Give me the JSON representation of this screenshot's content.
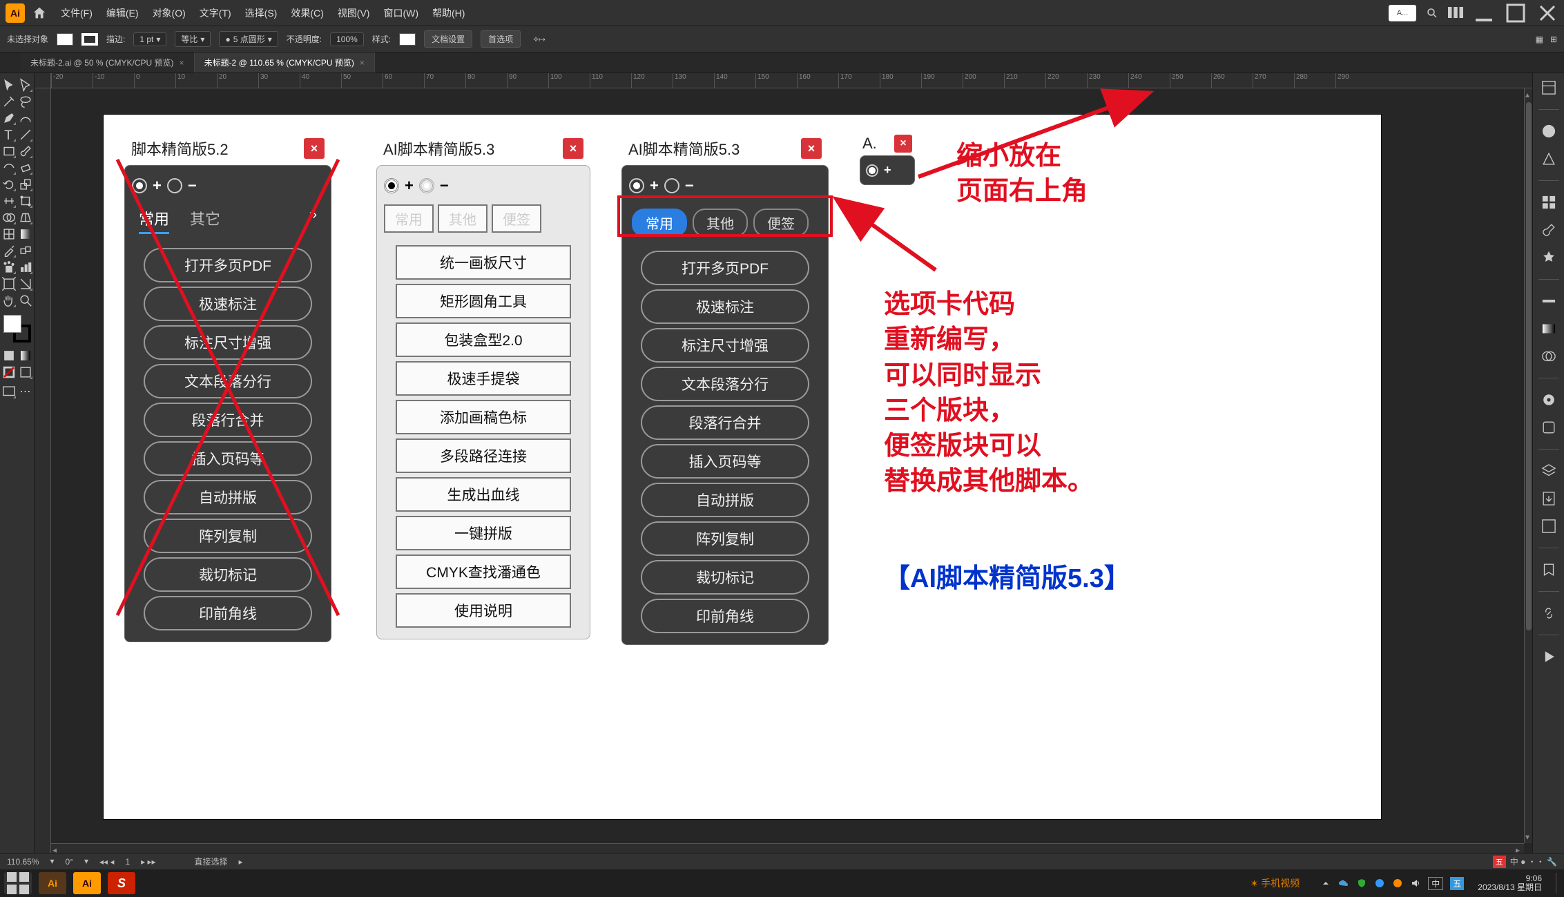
{
  "menu": {
    "items": [
      "文件(F)",
      "编辑(E)",
      "对象(O)",
      "文字(T)",
      "选择(S)",
      "效果(C)",
      "视图(V)",
      "窗口(W)",
      "帮助(H)"
    ],
    "searchPlaceholder": "A..."
  },
  "control": {
    "noSelection": "未选择对象",
    "strokeLabel": "描边:",
    "strokeValue": "1 pt",
    "uniformLabel": "等比",
    "brushLabel": "5 点圆形",
    "opacityLabel": "不透明度:",
    "opacityValue": "100%",
    "styleLabel": "样式:",
    "docSetup": "文档设置",
    "prefs": "首选项"
  },
  "tabs": [
    {
      "label": "未标题-2.ai @ 50 % (CMYK/CPU 预览)",
      "active": false
    },
    {
      "label": "未标题-2 @ 110.65 % (CMYK/CPU 预览)",
      "active": true
    }
  ],
  "ruler": [
    "-20",
    "-10",
    "0",
    "10",
    "20",
    "30",
    "40",
    "50",
    "60",
    "70",
    "80",
    "90",
    "100",
    "110",
    "120",
    "130",
    "140",
    "150",
    "160",
    "170",
    "180",
    "190",
    "200",
    "210",
    "220",
    "230",
    "240",
    "250",
    "260",
    "270",
    "280",
    "290"
  ],
  "panel52": {
    "title": "脚本精简版5.2",
    "tabs": [
      "常用",
      "其它"
    ],
    "buttons": [
      "打开多页PDF",
      "极速标注",
      "标注尺寸增强",
      "文本段落分行",
      "段落行合并",
      "插入页码等",
      "自动拼版",
      "阵列复制",
      "裁切标记",
      "印前角线"
    ]
  },
  "panel53Light": {
    "title": "AI脚本精简版5.3",
    "tabs": [
      "常用",
      "其他",
      "便签"
    ],
    "buttons": [
      "统一画板尺寸",
      "矩形圆角工具",
      "包装盒型2.0",
      "极速手提袋",
      "添加画稿色标",
      "多段路径连接",
      "生成出血线",
      "一键拼版",
      "CMYK查找潘通色",
      "使用说明"
    ]
  },
  "panel53Dark": {
    "title": "AI脚本精简版5.3",
    "tabs": [
      "常用",
      "其他",
      "便签"
    ],
    "buttons": [
      "打开多页PDF",
      "极速标注",
      "标注尺寸增强",
      "文本段落分行",
      "段落行合并",
      "插入页码等",
      "自动拼版",
      "阵列复制",
      "裁切标记",
      "印前角线"
    ]
  },
  "panel53Mini": {
    "title": "A."
  },
  "annotations": {
    "top1": "缩小放在",
    "top2": "页面右上角",
    "body": "选项卡代码\n重新编写，\n可以同时显示\n三个版块，\n便签版块可以\n替换成其他脚本。",
    "footer": "【AI脚本精简版5.3】"
  },
  "status": {
    "zoom": "110.65%",
    "rotation": "0°",
    "artboard": "1",
    "toolLabel": "直接选择"
  },
  "taskbar": {
    "time": "9:06",
    "date": "2023/8/13 星期日",
    "ime": "中",
    "watermark": "手机视频"
  }
}
